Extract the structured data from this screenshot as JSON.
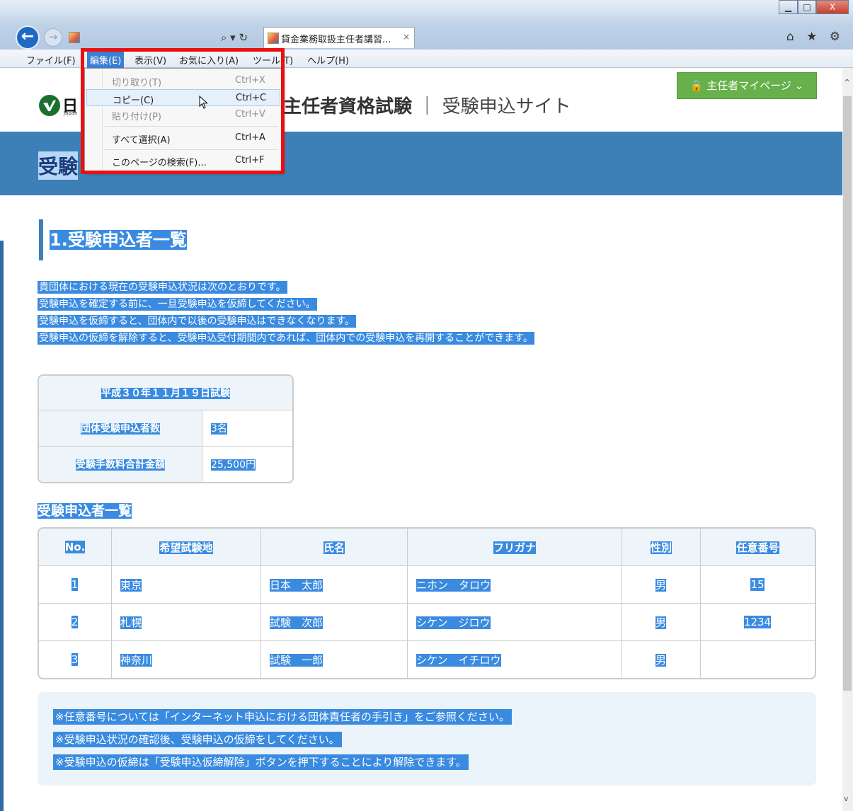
{
  "browser": {
    "tab_title": "貸金業務取扱主任者講習...",
    "tab_close": "×",
    "search_symbol": "⌕ ▾ ↻",
    "win_min": "▁",
    "win_max": "□",
    "win_close": "X",
    "toolbar_icons": "⌂ ★ ⚙",
    "back_symbol": "←",
    "forward_symbol": "→"
  },
  "menubar": {
    "file": "ファイル(F)",
    "edit": "編集(E)",
    "view": "表示(V)",
    "favorites": "お気に入り(A)",
    "tools": "ツール(T)",
    "help": "ヘルプ(H)"
  },
  "edit_menu": {
    "cut": {
      "label": "切り取り(T)",
      "shortcut": "Ctrl+X"
    },
    "copy": {
      "label": "コピー(C)",
      "shortcut": "Ctrl+C"
    },
    "paste": {
      "label": "貼り付け(P)",
      "shortcut": "Ctrl+V"
    },
    "select_all": {
      "label": "すべて選択(A)",
      "shortcut": "Ctrl+A"
    },
    "find": {
      "label": "このページの検索(F)...",
      "shortcut": "Ctrl+F"
    }
  },
  "header": {
    "logo_text": "日",
    "logo_sub": "Japan",
    "site_title_main": "主任者資格試験",
    "site_title_sep": "｜",
    "site_title_sub": "受験申込サイト",
    "mypage_label": "主任者マイページ ⌄",
    "banner_title": "受験"
  },
  "section1": {
    "heading": "1.受験申込者一覧",
    "lines": [
      "貴団体における現在の受験申込状況は次のとおりです。",
      "受験申込を確定する前に、一旦受験申込を仮締してください。",
      "受験申込を仮締すると、団体内で以後の受験申込はできなくなります。",
      "受験申込の仮締を解除すると、受験申込受付期間内であれば、団体内での受験申込を再開することができます。"
    ]
  },
  "summary": {
    "exam_date": "平成３０年１１月１９日試験",
    "applicants_label": "団体受験申込者数",
    "applicants_value": "3名",
    "fee_label": "受験手数料合計金額",
    "fee_value": "25,500円"
  },
  "list": {
    "title": "受験申込者一覧",
    "columns": [
      "No.",
      "希望試験地",
      "氏名",
      "フリガナ",
      "性別",
      "任意番号"
    ],
    "rows": [
      [
        "1",
        "東京",
        "日本　太郎",
        "ニホン　タロウ",
        "男",
        "15"
      ],
      [
        "2",
        "札幌",
        "試験　次郎",
        "シケン　ジロウ",
        "男",
        "1234"
      ],
      [
        "3",
        "神奈川",
        "試験　一郎",
        "シケン　イチロウ",
        "男",
        ""
      ]
    ]
  },
  "notes": [
    "※任意番号については「インターネット申込における団体責任者の手引き」をご参照ください。",
    "※受験申込状況の確認後、受験申込の仮締をしてください。",
    "※受験申込の仮締は「受験申込仮締解除」ボタンを押下することにより解除できます。"
  ],
  "colors": {
    "selection": "#3a8be0",
    "banner": "#3d80b8",
    "highlight_box": "#ea1010",
    "mypage_button": "#67b04b"
  }
}
